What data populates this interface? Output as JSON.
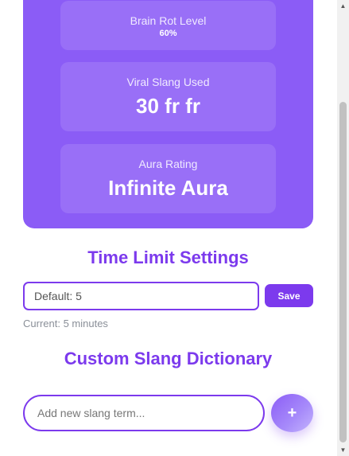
{
  "stats": {
    "brain_rot": {
      "label": "Brain Rot Level",
      "value": "60%"
    },
    "viral_slang": {
      "label": "Viral Slang Used",
      "value": "30 fr fr"
    },
    "aura": {
      "label": "Aura Rating",
      "value": "Infinite Aura"
    }
  },
  "time_limit": {
    "title": "Time Limit Settings",
    "input_placeholder": "Default: 5",
    "save_label": "Save",
    "current_text": "Current: 5 minutes"
  },
  "slang_dictionary": {
    "title": "Custom Slang Dictionary",
    "input_placeholder": "Add new slang term...",
    "add_label": "+"
  },
  "colors": {
    "accent": "#7c3aed",
    "card": "#8b5cf6"
  }
}
